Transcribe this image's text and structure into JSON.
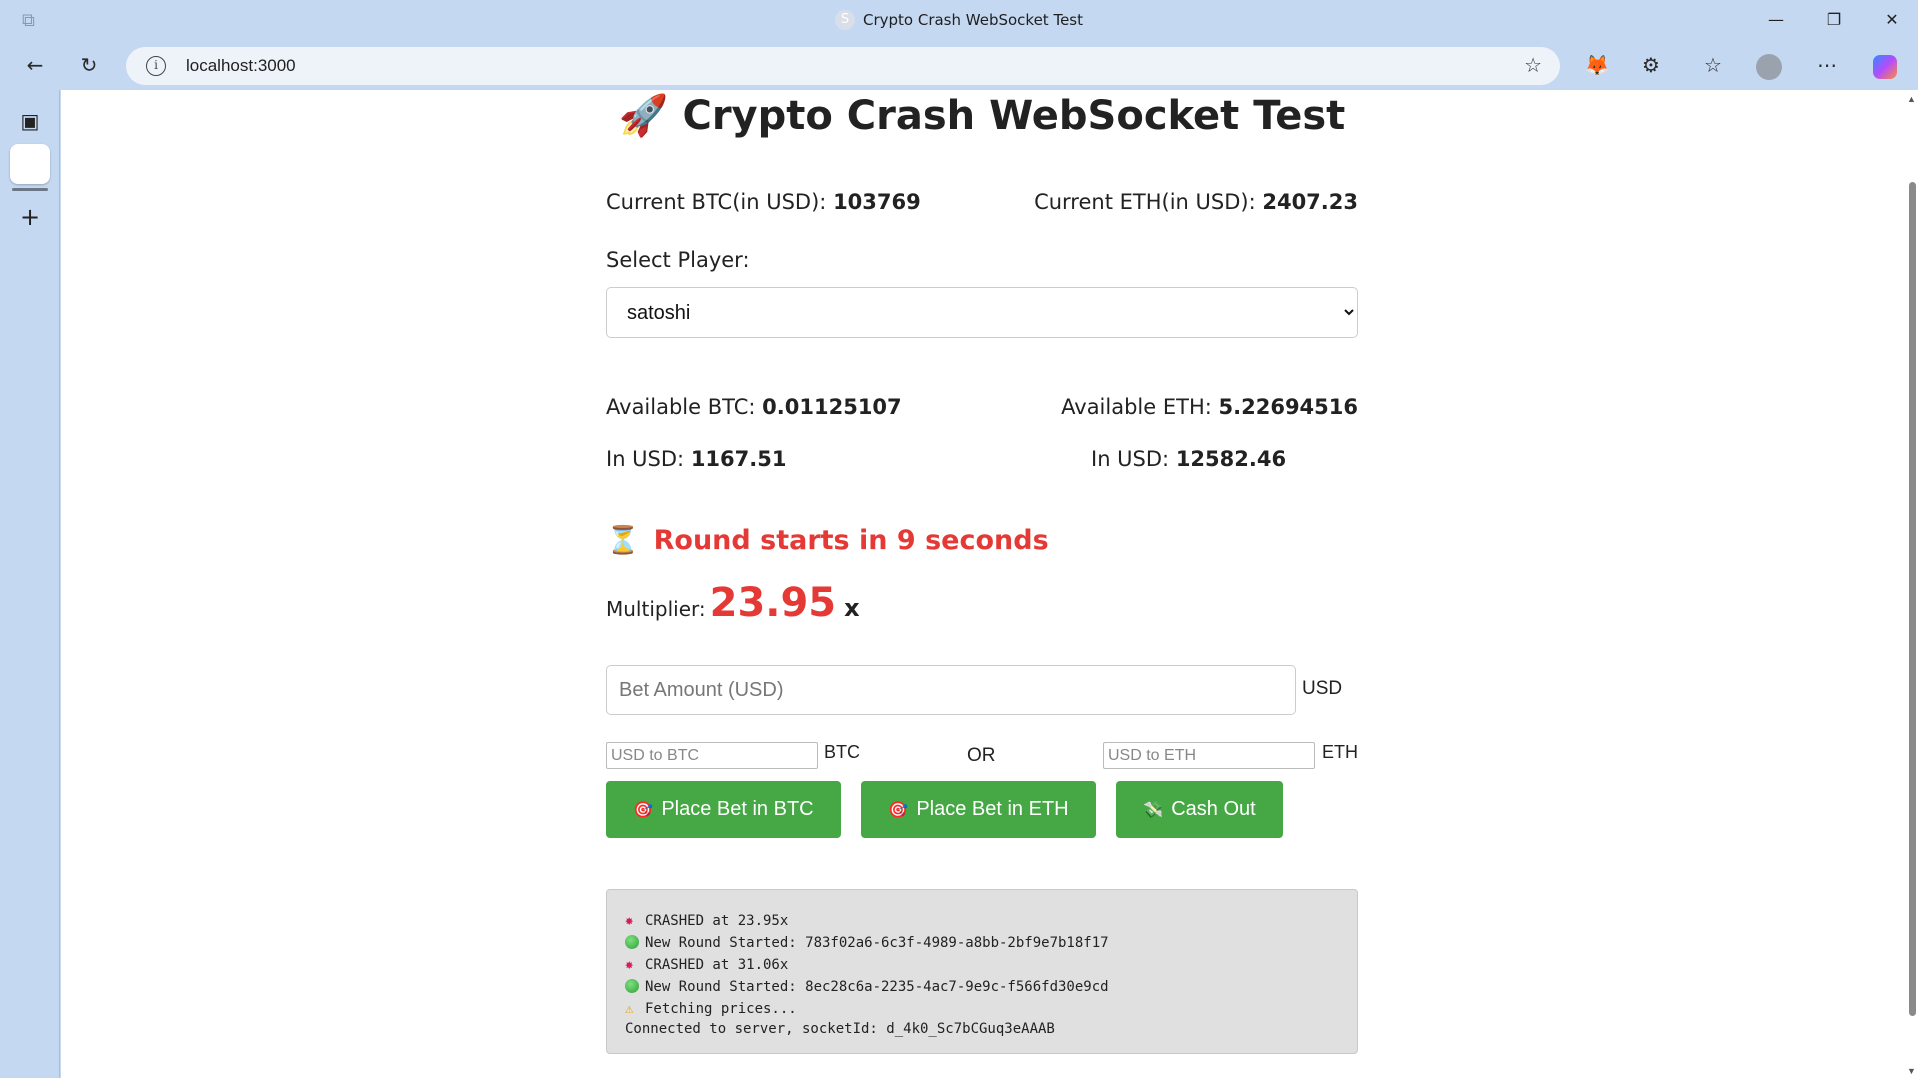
{
  "window": {
    "title": "Crypto Crash WebSocket Test",
    "favicon_letter": "S"
  },
  "browser": {
    "url": "localhost:3000"
  },
  "header": {
    "rocket": "🚀",
    "title": "Crypto Crash WebSocket Test"
  },
  "prices": {
    "btc_label": "Current BTC(in USD):",
    "btc_value": "103769",
    "eth_label": "Current ETH(in USD):",
    "eth_value": "2407.23"
  },
  "player": {
    "label": "Select Player:",
    "selected": "satoshi"
  },
  "balances": {
    "btc_label": "Available BTC:",
    "btc_value": "0.01125107",
    "eth_label": "Available ETH:",
    "eth_value": "5.22694516",
    "btc_usd_label": "In USD:",
    "btc_usd_value": "1167.51",
    "eth_usd_label": "In USD:",
    "eth_usd_value": "12582.46"
  },
  "round": {
    "hourglass": "⏳",
    "status": "Round starts in 9 seconds"
  },
  "multiplier": {
    "label": "Multiplier:",
    "value": "23.95",
    "suffix": "x"
  },
  "bet": {
    "placeholder": "Bet Amount (USD)",
    "suffix": "USD",
    "btc_placeholder": "USD to BTC",
    "btc_suffix": "BTC",
    "or_label": "OR",
    "eth_placeholder": "USD to ETH",
    "eth_suffix": "ETH"
  },
  "buttons": {
    "place_btc": "Place Bet in BTC",
    "place_eth": "Place Bet in ETH",
    "cash_out": "Cash Out",
    "target_icon": "🎯",
    "cash_icon": "💸"
  },
  "log": [
    {
      "icon": "crash",
      "text": "CRASHED at 23.95x"
    },
    {
      "icon": "new",
      "text": "New Round Started: 783f02a6-6c3f-4989-a8bb-2bf9e7b18f17"
    },
    {
      "icon": "crash",
      "text": "CRASHED at 31.06x"
    },
    {
      "icon": "new",
      "text": "New Round Started: 8ec28c6a-2235-4ac7-9e9c-f566fd30e9cd"
    },
    {
      "icon": "warn",
      "text": "Fetching prices..."
    },
    {
      "icon": "none",
      "text": "Connected to server, socketId: d_4k0_Sc7bCGuq3eAAAB"
    }
  ]
}
